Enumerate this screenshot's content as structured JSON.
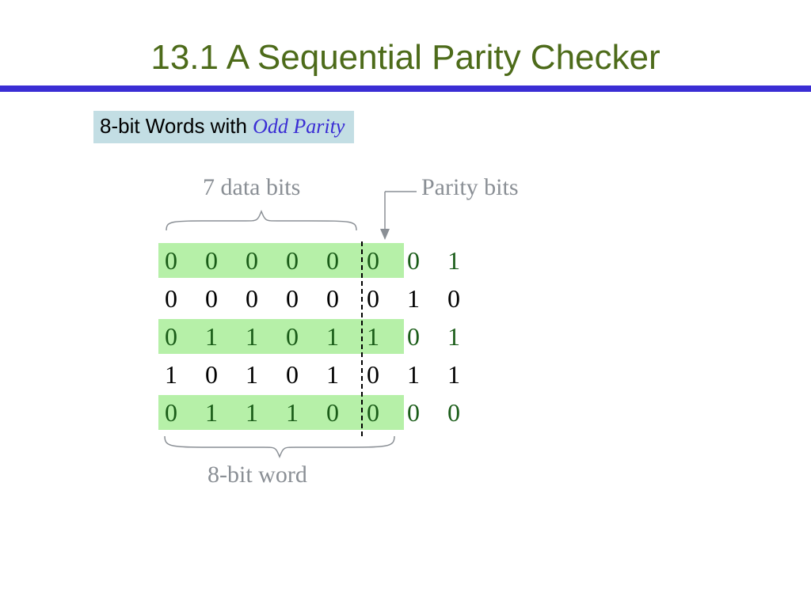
{
  "title": "13.1  A Sequential Parity Checker",
  "subtitle": {
    "prefix": "8-bit Words with ",
    "emph": "Odd Parity"
  },
  "labels": {
    "top_left": "7 data bits",
    "top_right": "Parity bits",
    "bottom": "8-bit word"
  },
  "rows": [
    {
      "bits": "0 0 0 0 0 0 0 1",
      "highlight": true
    },
    {
      "bits": "0 0 0 0 0 0 1 0",
      "highlight": false
    },
    {
      "bits": "0 1 1 0 1 1 0 1",
      "highlight": true
    },
    {
      "bits": "1 0 1 0 1 0 1 1",
      "highlight": false
    },
    {
      "bits": "0 1 1 1 0 0 0 0",
      "highlight": true
    }
  ]
}
